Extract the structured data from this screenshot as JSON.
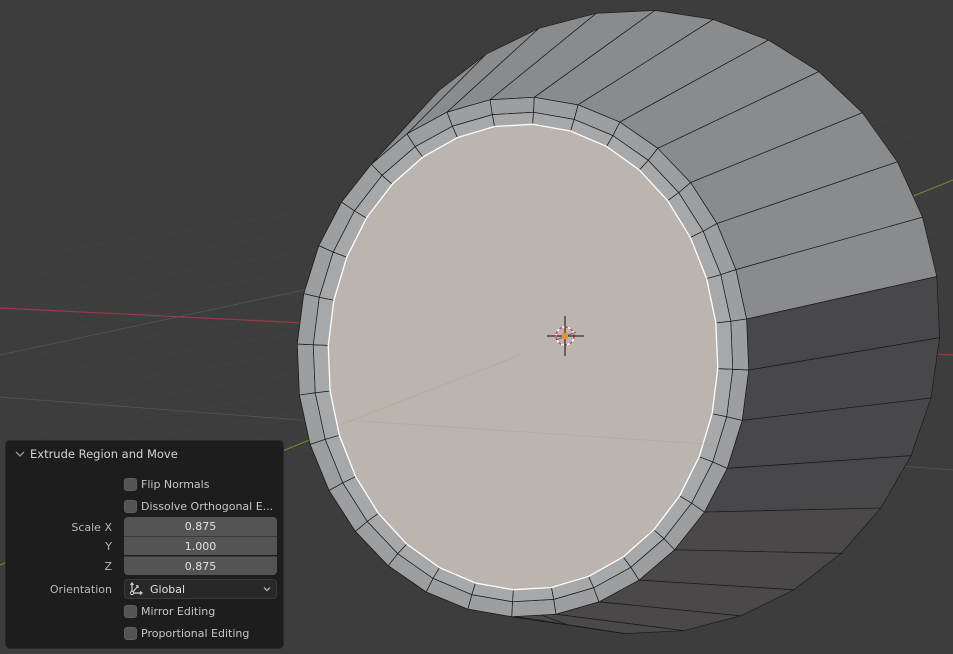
{
  "viewport": {
    "mode": "Edit Mode",
    "colors": {
      "background": "#3d3d3d",
      "grid_line": "#4a4a4a",
      "x_axis": "#9a3a46",
      "y_axis": "#6a8a32",
      "selected_face": "#bcb4ae",
      "selected_edge": "#ffffff",
      "mesh_light": "#a6a8a9",
      "mesh_mid": "#8a8b8d",
      "mesh_dark": "#48474a",
      "cursor_ring": "#d04848"
    }
  },
  "operator_panel": {
    "title": "Extrude Region and Move",
    "checkboxes_top": [
      {
        "label": "Flip Normals",
        "checked": false
      },
      {
        "label": "Dissolve Orthogonal E...",
        "checked": false
      }
    ],
    "scale": {
      "label_x": "Scale X",
      "label_y": "Y",
      "label_z": "Z",
      "x": "0.875",
      "y": "1.000",
      "z": "0.875"
    },
    "orientation": {
      "label": "Orientation",
      "value": "Global",
      "icon": "orientation-global-icon"
    },
    "checkboxes_bottom": [
      {
        "label": "Mirror Editing",
        "checked": false
      },
      {
        "label": "Proportional Editing",
        "checked": false
      }
    ]
  }
}
